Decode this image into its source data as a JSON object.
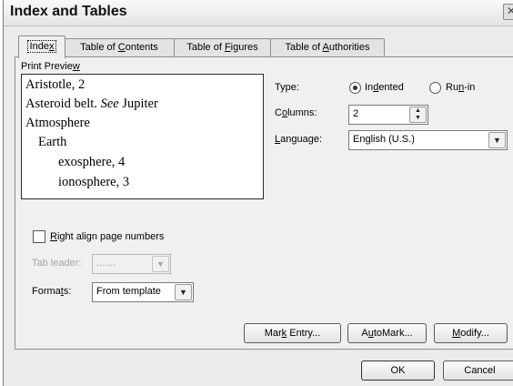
{
  "window": {
    "title": "Index and Tables"
  },
  "tabs": [
    {
      "label": "Index",
      "active": true
    },
    {
      "label": "Table of Contents"
    },
    {
      "label": "Table of Figures"
    },
    {
      "label": "Table of Authorities"
    }
  ],
  "preview": {
    "label": "Print Preview",
    "lines": [
      {
        "text": "Aristotle, 2",
        "indent": 0
      },
      {
        "text": "Asteroid belt. See Jupiter",
        "main": "Asteroid belt. ",
        "see": "See",
        "rest": " Jupiter",
        "indent": 0
      },
      {
        "text": "Atmosphere",
        "indent": 0
      },
      {
        "text": "Earth",
        "indent": 1
      },
      {
        "text": "exosphere, 4",
        "indent": 2
      },
      {
        "text": "ionosphere, 3",
        "indent": 2
      }
    ]
  },
  "options": {
    "type_label": "Type:",
    "type_options": [
      {
        "label": "Indented",
        "selected": true
      },
      {
        "label": "Run-in",
        "selected": false
      }
    ],
    "columns_label": "Columns:",
    "columns_value": "2",
    "language_label": "Language:",
    "language_value": "English (U.S.)"
  },
  "right_align": {
    "label": "Right align page numbers",
    "checked": false
  },
  "tab_leader": {
    "label": "Tab leader:",
    "value": ".......",
    "enabled": false
  },
  "formats": {
    "label": "Formats:",
    "value": "From template"
  },
  "buttons": {
    "mark_entry": "Mark Entry...",
    "automark": "AutoMark...",
    "modify": "Modify...",
    "ok": "OK",
    "cancel": "Cancel"
  },
  "icons": {
    "close": "close-icon",
    "scroll_up": "arrow-up-icon",
    "scroll_down": "arrow-down-icon",
    "dropdown": "chevron-down-icon",
    "spinner": "spinner-icon"
  }
}
